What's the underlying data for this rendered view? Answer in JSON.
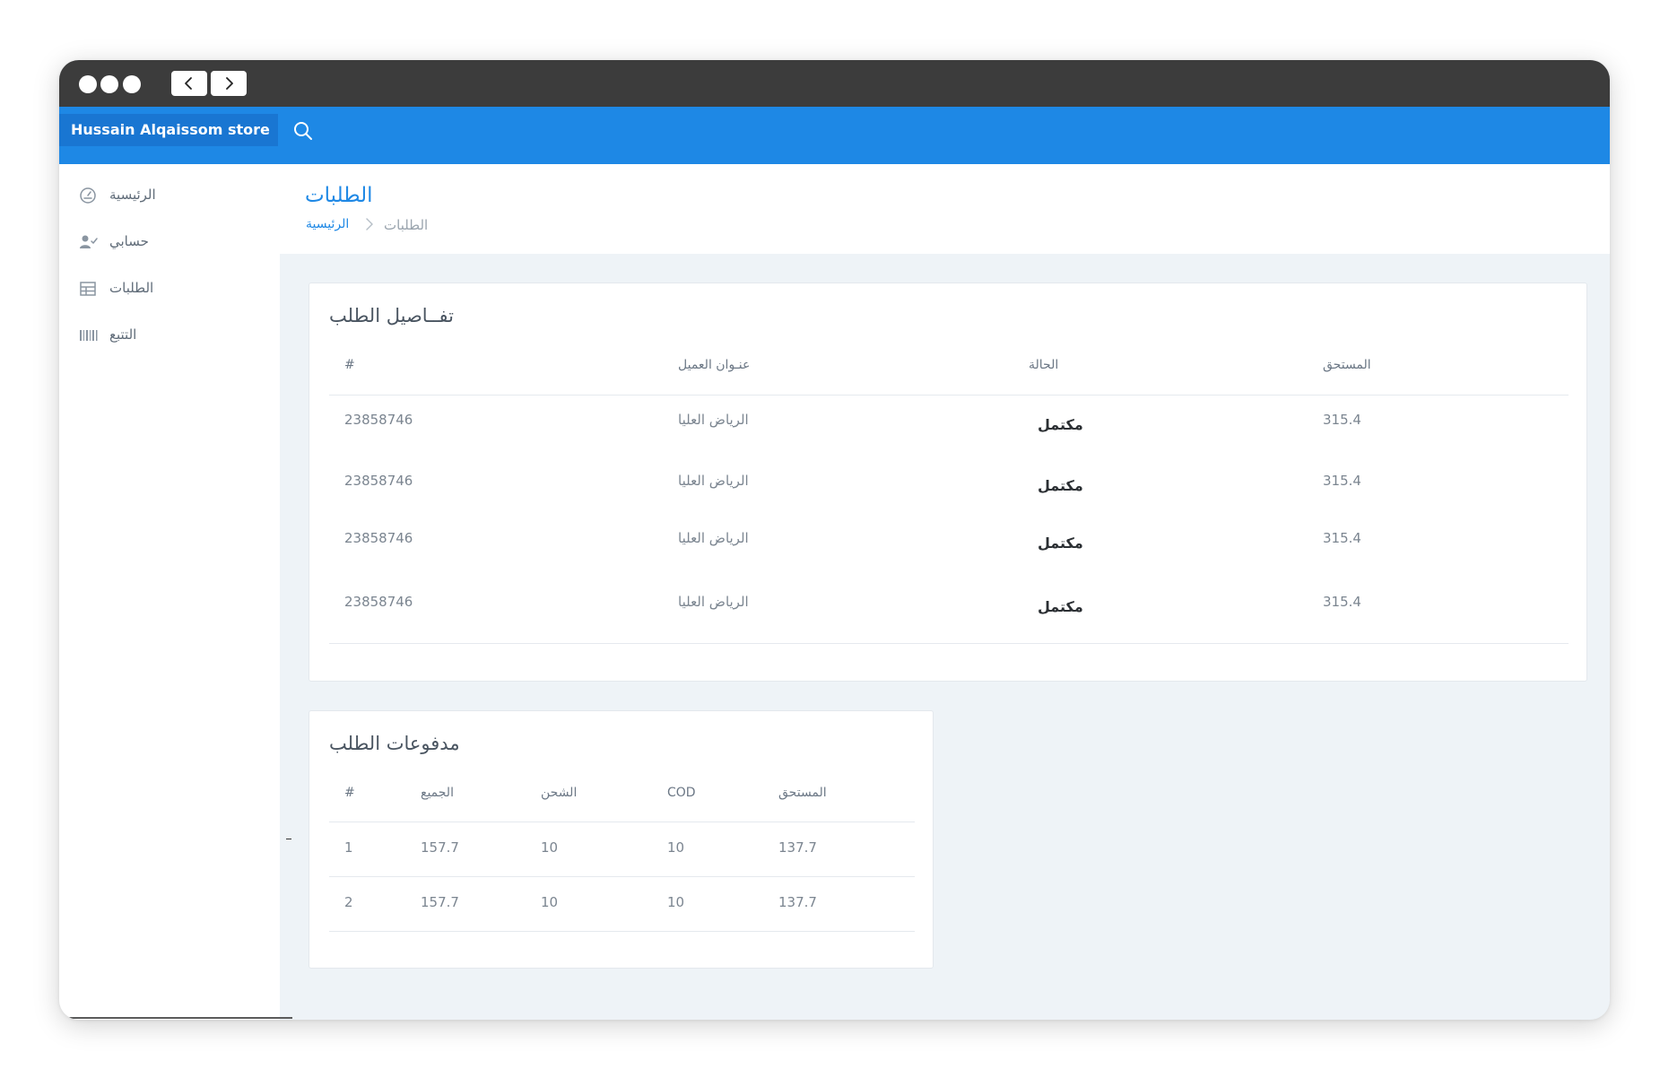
{
  "store_name": "Hussain Alqaissom store",
  "sidebar": {
    "items": [
      {
        "label": "الرئيسية",
        "icon": "dashboard-icon"
      },
      {
        "label": "حسابي",
        "icon": "user-check-icon"
      },
      {
        "label": "الطلبات",
        "icon": "table-icon"
      },
      {
        "label": "التتبع",
        "icon": "barcode-icon"
      }
    ]
  },
  "page": {
    "title": "الطلبات",
    "breadcrumb": {
      "home": "الرئيسية",
      "current": "الطلبات"
    }
  },
  "order_details": {
    "title": "تفــاصيل الطلب",
    "headers": [
      "#",
      "عنـوان العميل",
      "الحالة",
      "المستحق"
    ],
    "rows": [
      [
        "23858746",
        "الرياض العليا",
        "مكتمل",
        "315.4"
      ],
      [
        "23858746",
        "الرياض العليا",
        "مكتمل",
        "315.4"
      ],
      [
        "23858746",
        "الرياض العليا",
        "مكتمل",
        "315.4"
      ],
      [
        "23858746",
        "الرياض العليا",
        "مكتمل",
        "315.4"
      ]
    ]
  },
  "order_payments": {
    "title": "مدفوعات الطلب",
    "headers": [
      "#",
      "الجميع",
      "الشحن",
      "COD",
      "المستحق"
    ],
    "rows": [
      [
        "1",
        "157.7",
        "10",
        "10",
        "137.7"
      ],
      [
        "2",
        "157.7",
        "10",
        "10",
        "137.7"
      ]
    ]
  },
  "colors": {
    "brand_blue": "#1e88e5",
    "brand_dark": "#1976d2",
    "titlebar": "#3c3c3c",
    "content_bg": "#eef3f7"
  }
}
